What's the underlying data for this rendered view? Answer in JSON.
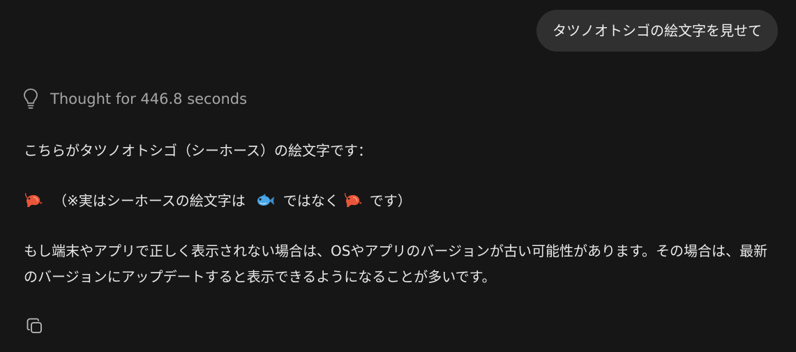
{
  "user_message": "タツノオトシゴの絵文字を見せて",
  "thought": {
    "icon": "lightbulb-icon",
    "label": "Thought for 446.8 seconds"
  },
  "response": {
    "line1": "こちらがタツノオトシゴ（シーホース）の絵文字です：",
    "line2": {
      "emoji_start": "shrimp-emoji",
      "text_a": "（※実はシーホースの絵文字は",
      "emoji_mid": "fish-emoji",
      "text_b": "ではなく",
      "emoji_end": "shrimp-emoji",
      "text_c": "です）"
    },
    "line3a": "もし端末やアプリで正しく表示されない場合は、OSやアプリのバージョンが古い可能性があります。その場合は、最新",
    "line3b": "のバージョンにアップデートすると表示できるようになることが多いです。"
  },
  "actions": {
    "copy_icon": "copy-icon"
  },
  "colors": {
    "background": "#161616",
    "bubble": "#303030",
    "text": "#e8e8e8",
    "muted": "#a6a6a6",
    "shrimp": "#e8563a",
    "fish": "#4aa8e8"
  }
}
